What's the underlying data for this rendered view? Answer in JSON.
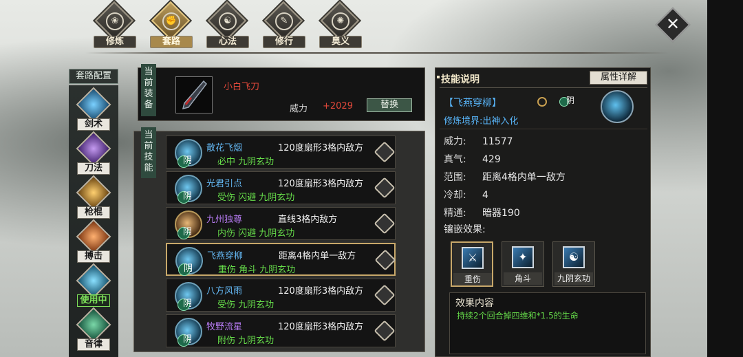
{
  "nav": {
    "tabs": [
      {
        "label": "修炼",
        "icon": "lotus-icon"
      },
      {
        "label": "套路",
        "icon": "fist-icon"
      },
      {
        "label": "心法",
        "icon": "yinyang-icon"
      },
      {
        "label": "修行",
        "icon": "scroll-icon"
      },
      {
        "label": "奥义",
        "icon": "flame-icon"
      }
    ],
    "active_index": 1
  },
  "close_glyph": "✕",
  "set_config": {
    "title": "套路配置",
    "items": [
      {
        "label": "剑术",
        "icon": "sword-icon",
        "color": "#4aa6e0"
      },
      {
        "label": "刀法",
        "icon": "blade-icon",
        "color": "#8a5ad0"
      },
      {
        "label": "枪棍",
        "icon": "spear-icon",
        "color": "#e0a030"
      },
      {
        "label": "搏击",
        "icon": "fist-icon",
        "color": "#e07030"
      },
      {
        "label": "使用中",
        "icon": "dart-icon",
        "color": "#4ab8e8"
      },
      {
        "label": "音律",
        "icon": "music-icon",
        "color": "#3a9a6a"
      }
    ],
    "active_index": 4
  },
  "equip": {
    "tag": "当前装备",
    "name": "小白飞刀",
    "power_label": "威力",
    "power_value": "+2029",
    "swap_label": "替换"
  },
  "skills": {
    "tag": "当前技能",
    "rows": [
      {
        "name": "散花飞烟",
        "range": "120度扇形3格内敌方",
        "effects": "必中 九阴玄功",
        "yin": "阴",
        "name_color": "blue"
      },
      {
        "name": "光君引点",
        "range": "120度扇形3格内敌方",
        "effects": "受伤 闪避 九阴玄功",
        "yin": "阴",
        "name_color": "blue"
      },
      {
        "name": "九州独尊",
        "range": "直线3格内敌方",
        "effects": "内伤 闪避 九阴玄功",
        "yin": "阴",
        "name_color": "purple"
      },
      {
        "name": "飞燕穿柳",
        "range": "距离4格内单一敌方",
        "effects": "重伤 角斗 九阴玄功",
        "yin": "阴",
        "name_color": "blue"
      },
      {
        "name": "八方风雨",
        "range": "120度扇形3格内敌方",
        "effects": "受伤 九阴玄功",
        "yin": "阴",
        "name_color": "blue"
      },
      {
        "name": "牧野流星",
        "range": "120度扇形3格内敌方",
        "effects": "附伤 九阴玄功",
        "yin": "阴",
        "name_color": "purple"
      }
    ],
    "active_index": 3
  },
  "detail": {
    "header": "技能说明",
    "attr_button": "属性详解",
    "skill_title": "【飞燕穿柳】",
    "mini_yin": "阴",
    "realm": "修炼境界:出神入化",
    "stats": [
      {
        "k": "威力:",
        "v": "11577"
      },
      {
        "k": "真气:",
        "v": "429"
      },
      {
        "k": "范围:",
        "v": "距离4格内单一敌方"
      },
      {
        "k": "冷却:",
        "v": "4"
      },
      {
        "k": "精通:",
        "v": "暗器190"
      }
    ],
    "inlay_label": "镶嵌效果:",
    "inlays": [
      {
        "name": "重伤",
        "glyph": "⚔"
      },
      {
        "name": "角斗",
        "glyph": "✦"
      },
      {
        "name": "九阴玄功",
        "glyph": "☯"
      }
    ],
    "inlay_active_index": 0,
    "effect_title": "效果内容",
    "effect_text": "持续2个回合掉四维和*1.5的生命"
  }
}
